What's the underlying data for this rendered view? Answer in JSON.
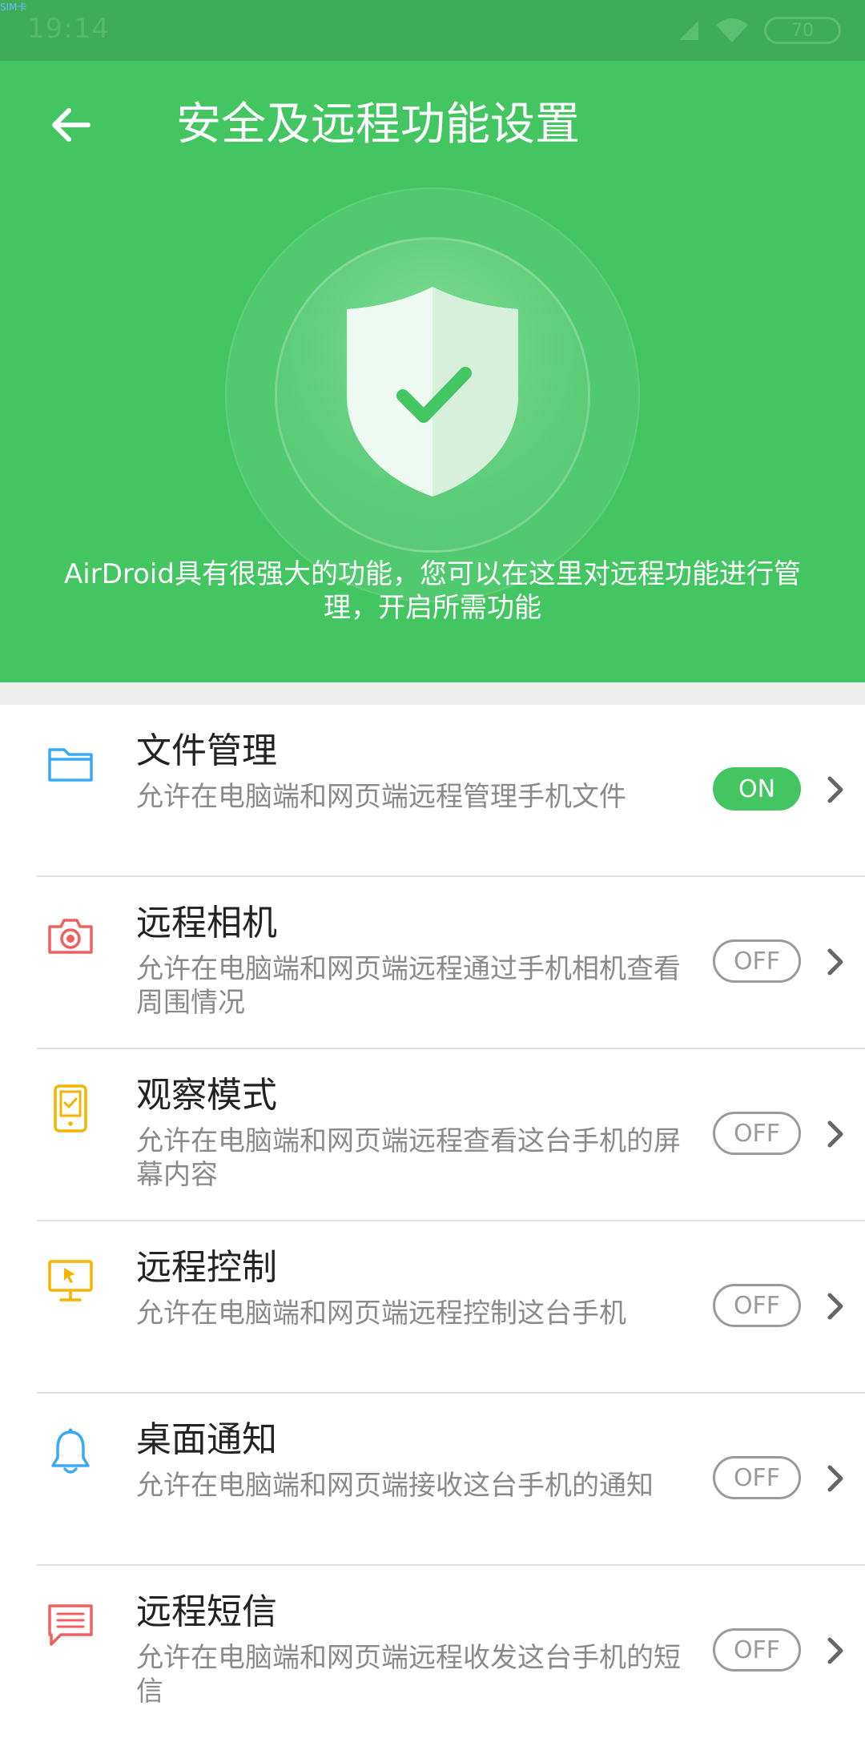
{
  "status_bar": {
    "corner_label": "SIM卡",
    "time": "19:14",
    "battery": "70"
  },
  "header": {
    "title": "安全及远程功能设置",
    "description": "AirDroid具有很强大的功能，您可以在这里对远程功能进行管理，开启所需功能"
  },
  "colors": {
    "primary_green": "#43c562",
    "status_green": "#3fad58",
    "blue_icon": "#3aa9f4",
    "red_icon": "#f06060",
    "yellow_icon": "#f4b400"
  },
  "features": [
    {
      "title": "文件管理",
      "desc": "允许在电脑端和网页端远程管理手机文件",
      "state": "ON",
      "icon": "folder-icon"
    },
    {
      "title": "远程相机",
      "desc": "允许在电脑端和网页端远程通过手机相机查看周围情况",
      "state": "OFF",
      "icon": "camera-icon"
    },
    {
      "title": "观察模式",
      "desc": "允许在电脑端和网页端远程查看这台手机的屏幕内容",
      "state": "OFF",
      "icon": "phone-screen-icon"
    },
    {
      "title": "远程控制",
      "desc": "允许在电脑端和网页端远程控制这台手机",
      "state": "OFF",
      "icon": "monitor-cursor-icon"
    },
    {
      "title": "桌面通知",
      "desc": "允许在电脑端和网页端接收这台手机的通知",
      "state": "OFF",
      "icon": "bell-icon"
    },
    {
      "title": "远程短信",
      "desc": "允许在电脑端和网页端远程收发这台手机的短信",
      "state": "OFF",
      "icon": "message-icon"
    }
  ]
}
